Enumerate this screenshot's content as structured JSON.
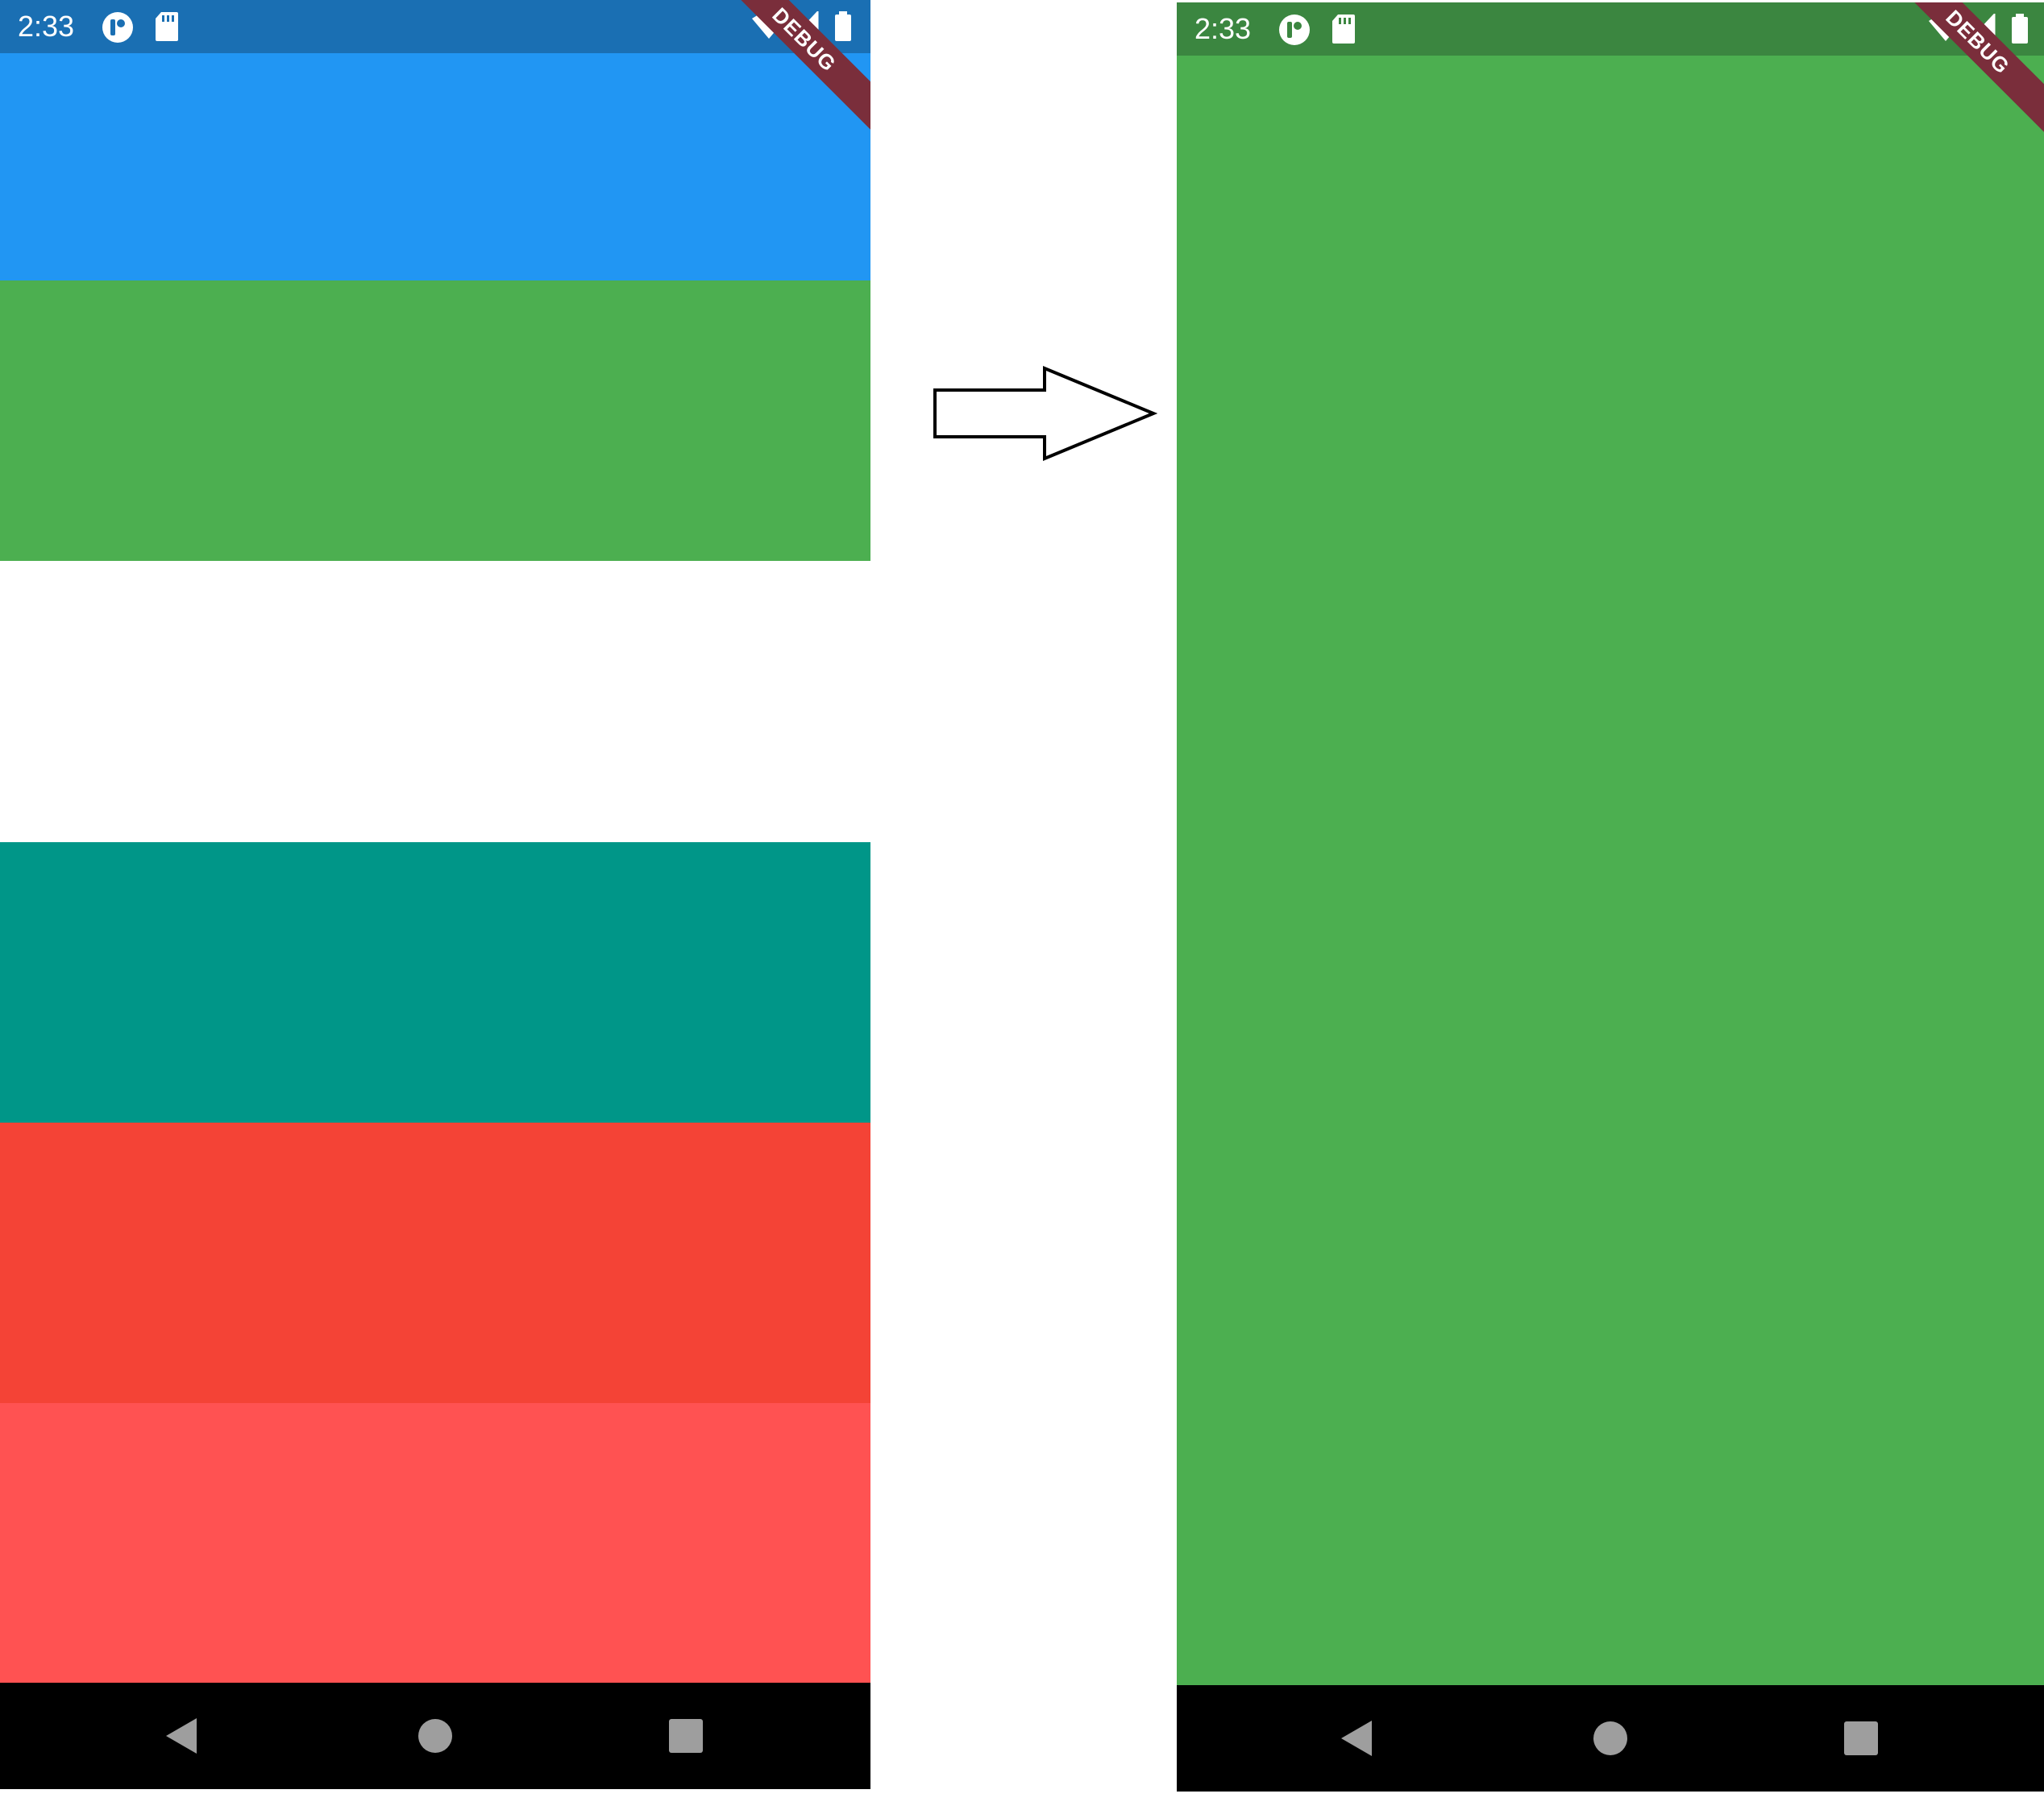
{
  "colors": {
    "page_bg": "#ffffff",
    "blue": "#2196f3",
    "blue_status": "#1a6fb3",
    "green": "#4caf50",
    "green_status": "#3b8640",
    "teal": "#009688",
    "red": "#f44336",
    "light_red": "#ff5252",
    "debug_banner": "#7a2e3b",
    "nav_bar": "#000000",
    "nav_icon": "#9e9e9e"
  },
  "left_screen": {
    "status_bar": {
      "time": "2:33",
      "icons": [
        "app-notification-icon",
        "sd-card-icon",
        "wifi-icon",
        "cell-signal-icon",
        "battery-icon"
      ]
    },
    "debug_banner": "DEBUG",
    "blocks": [
      {
        "name": "blue-block",
        "color": "#2196f3"
      },
      {
        "name": "green-block",
        "color": "#4caf50"
      },
      {
        "name": "white-block",
        "color": "#ffffff"
      },
      {
        "name": "teal-block",
        "color": "#009688"
      },
      {
        "name": "red-block",
        "color": "#f44336"
      },
      {
        "name": "light-red-block",
        "color": "#ff5252"
      }
    ],
    "nav_icons": [
      "back-icon",
      "home-icon",
      "recents-icon"
    ]
  },
  "arrow": {
    "icon": "right-arrow-icon"
  },
  "right_screen": {
    "status_bar": {
      "time": "2:33",
      "icons": [
        "app-notification-icon",
        "sd-card-icon",
        "wifi-icon",
        "cell-signal-icon",
        "battery-icon"
      ]
    },
    "debug_banner": "DEBUG",
    "blocks": [
      {
        "name": "green-fullscreen-block",
        "color": "#4caf50"
      }
    ],
    "nav_icons": [
      "back-icon",
      "home-icon",
      "recents-icon"
    ]
  }
}
